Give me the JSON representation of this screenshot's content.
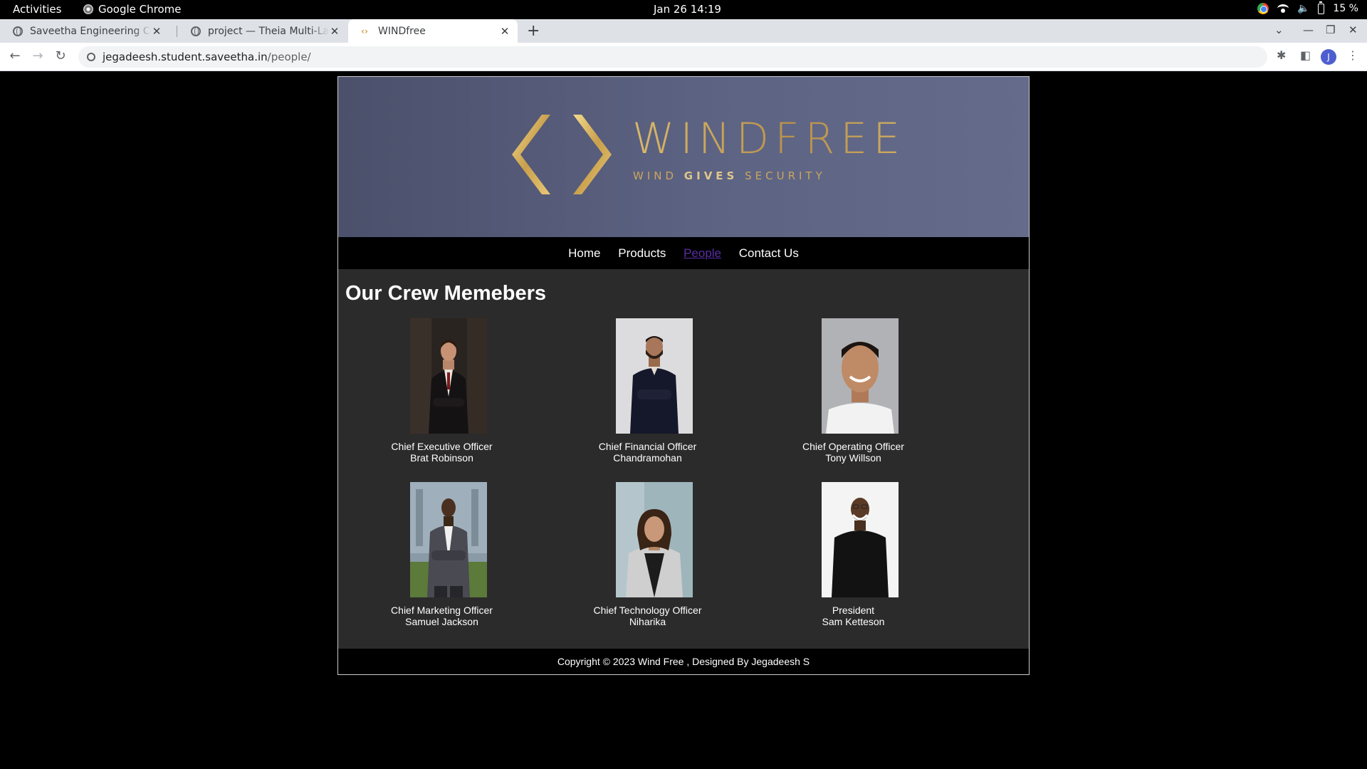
{
  "os": {
    "activities": "Activities",
    "app_name": "Google Chrome",
    "clock": "Jan 26  14:19",
    "battery": "15 %"
  },
  "browser": {
    "tabs": [
      {
        "title": "Saveetha Engineering College"
      },
      {
        "title": "project — Theia Multi-Language"
      },
      {
        "title": "WINDfree"
      }
    ],
    "url_host": "jegadeesh.student.saveetha.in",
    "url_path": "/people/",
    "profile_initial": "J"
  },
  "site": {
    "logo_text": "WINDFREE",
    "tagline_left": "WIND ",
    "tagline_mid": "GIVES",
    "tagline_right": " SECURITY",
    "nav": [
      "Home",
      "Products",
      "People",
      "Contact Us"
    ],
    "heading": "Our Crew Memebers",
    "members": [
      {
        "role": "Chief Executive Officer",
        "name": "Brat Robinson"
      },
      {
        "role": "Chief Financial Officer",
        "name": "Chandramohan"
      },
      {
        "role": "Chief Operating Officer",
        "name": "Tony Willson"
      },
      {
        "role": "Chief Marketing Officer",
        "name": "Samuel Jackson"
      },
      {
        "role": "Chief Technology Officer",
        "name": "Niharika"
      },
      {
        "role": "President",
        "name": "Sam Ketteson"
      }
    ],
    "footer": "Copyright © 2023 Wind Free , Designed By Jegadeesh S"
  },
  "colors": {
    "banner": "#5d6383",
    "gold": "#c5a55c",
    "content_bg": "#2b2b2b",
    "active_nav": "#5a2ea3"
  }
}
